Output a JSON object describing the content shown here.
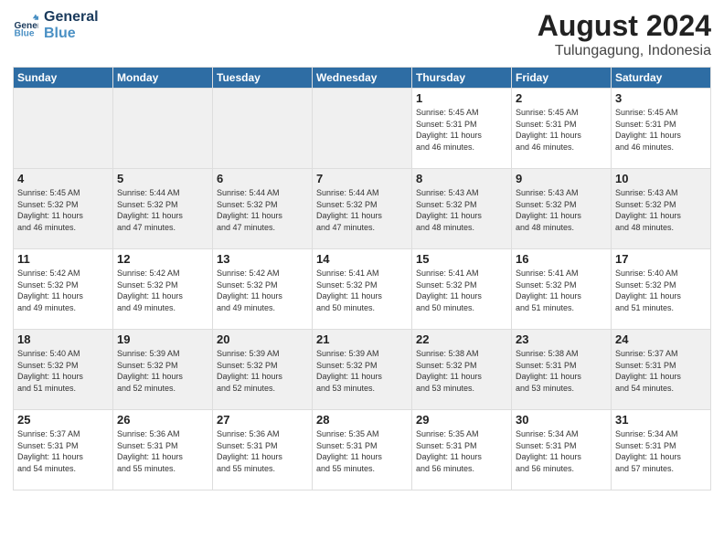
{
  "header": {
    "logo_general": "General",
    "logo_blue": "Blue",
    "main_title": "August 2024",
    "subtitle": "Tulungagung, Indonesia"
  },
  "days": [
    "Sunday",
    "Monday",
    "Tuesday",
    "Wednesday",
    "Thursday",
    "Friday",
    "Saturday"
  ],
  "weeks": [
    [
      {
        "date": "",
        "info": "",
        "shaded": true
      },
      {
        "date": "",
        "info": "",
        "shaded": true
      },
      {
        "date": "",
        "info": "",
        "shaded": true
      },
      {
        "date": "",
        "info": "",
        "shaded": true
      },
      {
        "date": "1",
        "info": "Sunrise: 5:45 AM\nSunset: 5:31 PM\nDaylight: 11 hours\nand 46 minutes.",
        "shaded": false
      },
      {
        "date": "2",
        "info": "Sunrise: 5:45 AM\nSunset: 5:31 PM\nDaylight: 11 hours\nand 46 minutes.",
        "shaded": false
      },
      {
        "date": "3",
        "info": "Sunrise: 5:45 AM\nSunset: 5:31 PM\nDaylight: 11 hours\nand 46 minutes.",
        "shaded": false
      }
    ],
    [
      {
        "date": "4",
        "info": "Sunrise: 5:45 AM\nSunset: 5:32 PM\nDaylight: 11 hours\nand 46 minutes.",
        "shaded": true
      },
      {
        "date": "5",
        "info": "Sunrise: 5:44 AM\nSunset: 5:32 PM\nDaylight: 11 hours\nand 47 minutes.",
        "shaded": true
      },
      {
        "date": "6",
        "info": "Sunrise: 5:44 AM\nSunset: 5:32 PM\nDaylight: 11 hours\nand 47 minutes.",
        "shaded": true
      },
      {
        "date": "7",
        "info": "Sunrise: 5:44 AM\nSunset: 5:32 PM\nDaylight: 11 hours\nand 47 minutes.",
        "shaded": true
      },
      {
        "date": "8",
        "info": "Sunrise: 5:43 AM\nSunset: 5:32 PM\nDaylight: 11 hours\nand 48 minutes.",
        "shaded": true
      },
      {
        "date": "9",
        "info": "Sunrise: 5:43 AM\nSunset: 5:32 PM\nDaylight: 11 hours\nand 48 minutes.",
        "shaded": true
      },
      {
        "date": "10",
        "info": "Sunrise: 5:43 AM\nSunset: 5:32 PM\nDaylight: 11 hours\nand 48 minutes.",
        "shaded": true
      }
    ],
    [
      {
        "date": "11",
        "info": "Sunrise: 5:42 AM\nSunset: 5:32 PM\nDaylight: 11 hours\nand 49 minutes.",
        "shaded": false
      },
      {
        "date": "12",
        "info": "Sunrise: 5:42 AM\nSunset: 5:32 PM\nDaylight: 11 hours\nand 49 minutes.",
        "shaded": false
      },
      {
        "date": "13",
        "info": "Sunrise: 5:42 AM\nSunset: 5:32 PM\nDaylight: 11 hours\nand 49 minutes.",
        "shaded": false
      },
      {
        "date": "14",
        "info": "Sunrise: 5:41 AM\nSunset: 5:32 PM\nDaylight: 11 hours\nand 50 minutes.",
        "shaded": false
      },
      {
        "date": "15",
        "info": "Sunrise: 5:41 AM\nSunset: 5:32 PM\nDaylight: 11 hours\nand 50 minutes.",
        "shaded": false
      },
      {
        "date": "16",
        "info": "Sunrise: 5:41 AM\nSunset: 5:32 PM\nDaylight: 11 hours\nand 51 minutes.",
        "shaded": false
      },
      {
        "date": "17",
        "info": "Sunrise: 5:40 AM\nSunset: 5:32 PM\nDaylight: 11 hours\nand 51 minutes.",
        "shaded": false
      }
    ],
    [
      {
        "date": "18",
        "info": "Sunrise: 5:40 AM\nSunset: 5:32 PM\nDaylight: 11 hours\nand 51 minutes.",
        "shaded": true
      },
      {
        "date": "19",
        "info": "Sunrise: 5:39 AM\nSunset: 5:32 PM\nDaylight: 11 hours\nand 52 minutes.",
        "shaded": true
      },
      {
        "date": "20",
        "info": "Sunrise: 5:39 AM\nSunset: 5:32 PM\nDaylight: 11 hours\nand 52 minutes.",
        "shaded": true
      },
      {
        "date": "21",
        "info": "Sunrise: 5:39 AM\nSunset: 5:32 PM\nDaylight: 11 hours\nand 53 minutes.",
        "shaded": true
      },
      {
        "date": "22",
        "info": "Sunrise: 5:38 AM\nSunset: 5:32 PM\nDaylight: 11 hours\nand 53 minutes.",
        "shaded": true
      },
      {
        "date": "23",
        "info": "Sunrise: 5:38 AM\nSunset: 5:31 PM\nDaylight: 11 hours\nand 53 minutes.",
        "shaded": true
      },
      {
        "date": "24",
        "info": "Sunrise: 5:37 AM\nSunset: 5:31 PM\nDaylight: 11 hours\nand 54 minutes.",
        "shaded": true
      }
    ],
    [
      {
        "date": "25",
        "info": "Sunrise: 5:37 AM\nSunset: 5:31 PM\nDaylight: 11 hours\nand 54 minutes.",
        "shaded": false
      },
      {
        "date": "26",
        "info": "Sunrise: 5:36 AM\nSunset: 5:31 PM\nDaylight: 11 hours\nand 55 minutes.",
        "shaded": false
      },
      {
        "date": "27",
        "info": "Sunrise: 5:36 AM\nSunset: 5:31 PM\nDaylight: 11 hours\nand 55 minutes.",
        "shaded": false
      },
      {
        "date": "28",
        "info": "Sunrise: 5:35 AM\nSunset: 5:31 PM\nDaylight: 11 hours\nand 55 minutes.",
        "shaded": false
      },
      {
        "date": "29",
        "info": "Sunrise: 5:35 AM\nSunset: 5:31 PM\nDaylight: 11 hours\nand 56 minutes.",
        "shaded": false
      },
      {
        "date": "30",
        "info": "Sunrise: 5:34 AM\nSunset: 5:31 PM\nDaylight: 11 hours\nand 56 minutes.",
        "shaded": false
      },
      {
        "date": "31",
        "info": "Sunrise: 5:34 AM\nSunset: 5:31 PM\nDaylight: 11 hours\nand 57 minutes.",
        "shaded": false
      }
    ]
  ]
}
